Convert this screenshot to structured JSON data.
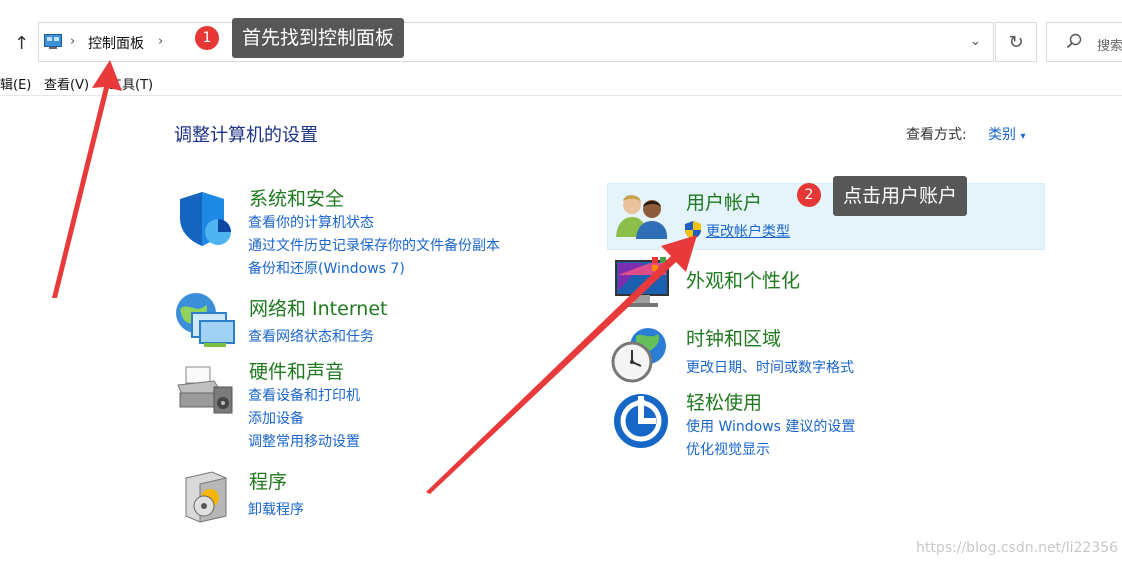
{
  "address_bar": {
    "breadcrumb": "控制面板",
    "search_placeholder": "搜索"
  },
  "menu": [
    {
      "label": "辑(E)"
    },
    {
      "label": "查看(V)"
    },
    {
      "label": "工具(T)"
    }
  ],
  "page_title": "调整计算机的设置",
  "view_by": {
    "label": "查看方式:",
    "value": "类别"
  },
  "categories_left": [
    {
      "title": "系统和安全",
      "links": [
        "查看你的计算机状态",
        "通过文件历史记录保存你的文件备份副本",
        "备份和还原(Windows 7)"
      ]
    },
    {
      "title": "网络和 Internet",
      "links": [
        "查看网络状态和任务"
      ]
    },
    {
      "title": "硬件和声音",
      "links": [
        "查看设备和打印机",
        "添加设备",
        "调整常用移动设置"
      ]
    },
    {
      "title": "程序",
      "links": [
        "卸载程序"
      ]
    }
  ],
  "categories_right": [
    {
      "title": "用户帐户",
      "links": [
        "更改帐户类型"
      ]
    },
    {
      "title": "外观和个性化",
      "links": []
    },
    {
      "title": "时钟和区域",
      "links": [
        "更改日期、时间或数字格式"
      ]
    },
    {
      "title": "轻松使用",
      "links": [
        "使用 Windows 建议的设置",
        "优化视觉显示"
      ]
    }
  ],
  "annotations": [
    {
      "badge": "1",
      "text": "首先找到控制面板"
    },
    {
      "badge": "2",
      "text": "点击用户账户"
    }
  ],
  "watermark": "https://blog.csdn.net/li22356",
  "colors": {
    "category_title": "#1f7a1f",
    "link": "#1a66cc",
    "page_title": "#1e3287",
    "highlight_bg": "#e5f3fb",
    "callout_bg": "#575757",
    "badge": "#e63636",
    "arrow": "#e83a3a"
  },
  "icons": {
    "up": "up-arrow-icon",
    "control_panel": "control-panel-icon",
    "refresh": "refresh-icon",
    "search": "search-icon",
    "system_security": "shield-icon",
    "network": "network-globe-icon",
    "hardware": "printer-icon",
    "programs": "programs-box-icon",
    "user_accounts": "users-icon",
    "uac": "uac-shield-icon",
    "appearance": "monitor-icon",
    "clock": "clock-globe-icon",
    "ease_of_access": "ease-of-access-icon"
  }
}
